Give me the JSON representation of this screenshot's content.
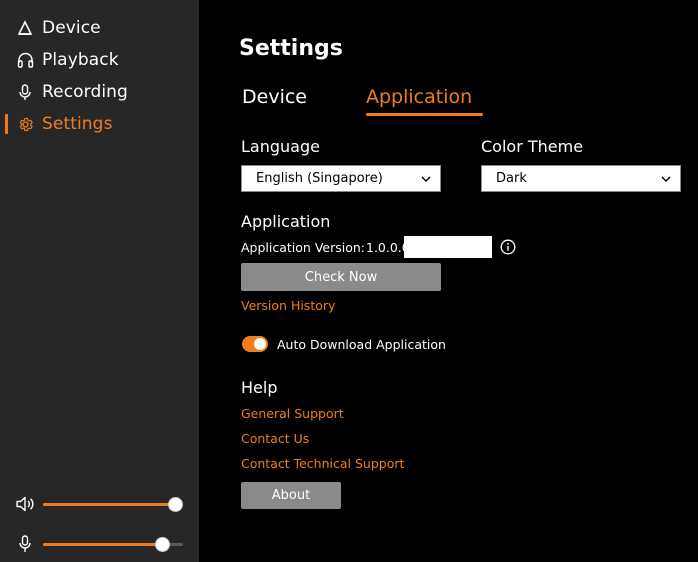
{
  "sidebar": {
    "items": [
      {
        "label": "Device",
        "icon": "device-icon",
        "active": false
      },
      {
        "label": "Playback",
        "icon": "headphones-icon",
        "active": false
      },
      {
        "label": "Recording",
        "icon": "microphone-icon",
        "active": false
      },
      {
        "label": "Settings",
        "icon": "gear-icon",
        "active": true
      }
    ],
    "volume": {
      "icon": "speaker-icon",
      "level": 0.94
    },
    "mic": {
      "icon": "microphone-icon",
      "level": 0.85
    }
  },
  "main": {
    "title": "Settings",
    "tabs": [
      {
        "label": "Device",
        "active": false
      },
      {
        "label": "Application",
        "active": true
      }
    ],
    "language": {
      "label": "Language",
      "value": "English (Singapore)"
    },
    "color_theme": {
      "label": "Color Theme",
      "value": "Dark"
    },
    "application": {
      "heading": "Application",
      "version_label": "Application Version:",
      "version_value": "1.0.0.0",
      "check_button": "Check Now",
      "history_link": "Version History",
      "auto_download_label": "Auto Download Application",
      "auto_download_enabled": true
    },
    "help": {
      "heading": "Help",
      "links": [
        "General Support",
        "Contact Us",
        "Contact Technical Support"
      ],
      "about_button": "About"
    }
  },
  "colors": {
    "accent": "#f07d1d",
    "sidebar_bg": "#272727",
    "main_bg": "#000000",
    "button_gray": "#8a8a8a"
  }
}
